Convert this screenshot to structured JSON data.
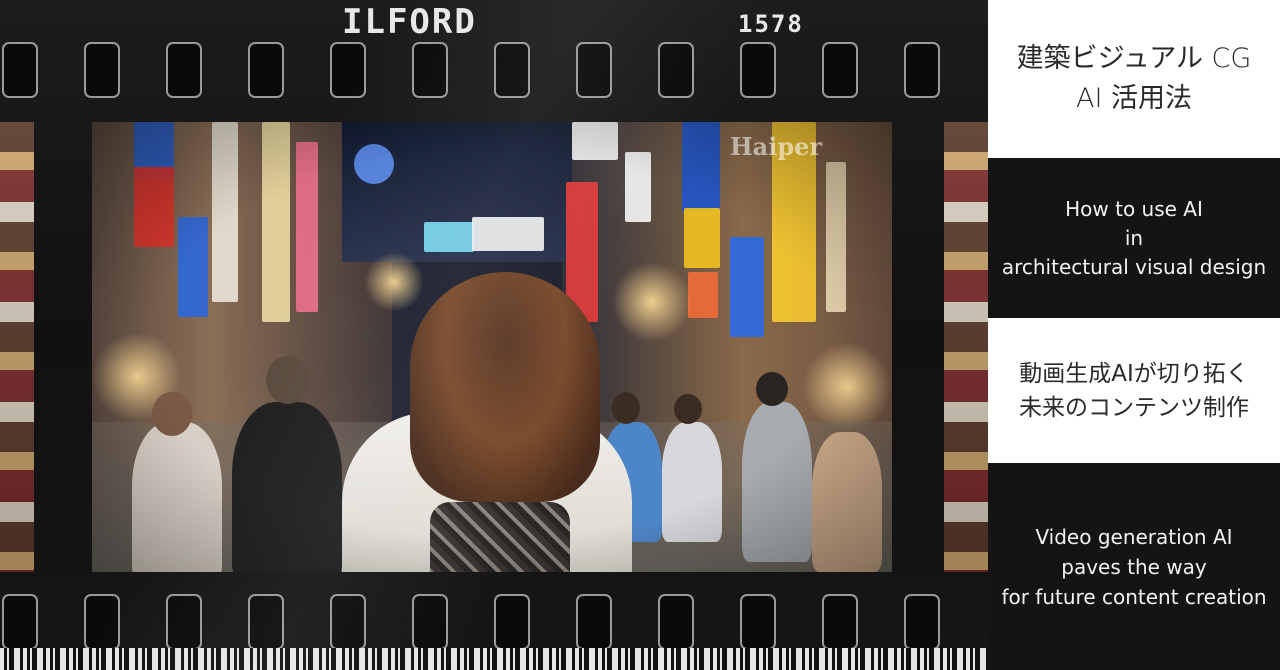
{
  "film": {
    "brand": "ILFORD",
    "frame_number": "1578",
    "watermark": "Haiper"
  },
  "panels": [
    {
      "text": "建築ビジュアル CG\nAI 活用法",
      "theme": "light"
    },
    {
      "text": "How to use AI\nin\narchitectural visual design",
      "theme": "dark"
    },
    {
      "text": "動画生成AIが切り拓く\n未来のコンテンツ制作",
      "theme": "light"
    },
    {
      "text": "Video generation AI\npaves the way\nfor future content creation",
      "theme": "dark"
    }
  ],
  "colors": {
    "film_base": "#111111",
    "panel_light": "#ffffff",
    "panel_dark": "#141414",
    "text_dark": "#2a2a2a",
    "text_light": "#f2f2f2"
  }
}
